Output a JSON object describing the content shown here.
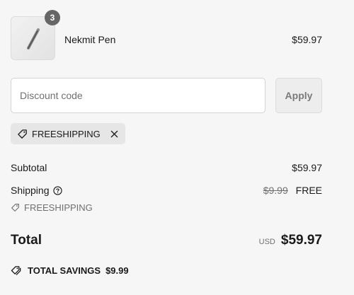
{
  "product": {
    "name": "Nekmit Pen",
    "price": "$59.97",
    "quantity": "3",
    "image_icon": "pen-image"
  },
  "discount": {
    "placeholder": "Discount code",
    "value": "",
    "apply_label": "Apply",
    "applied_code": "FREESHIPPING"
  },
  "summary": {
    "subtotal_label": "Subtotal",
    "subtotal_value": "$59.97",
    "shipping_label": "Shipping",
    "shipping_original": "$9.99",
    "shipping_value": "FREE",
    "shipping_code": "FREESHIPPING",
    "total_label": "Total",
    "currency": "USD",
    "total_value": "$59.97",
    "savings_label": "TOTAL SAVINGS",
    "savings_value": "$9.99"
  },
  "colors": {
    "background": "#f6f6f6",
    "badge": "#666666",
    "chip": "#e6e6e6",
    "muted_text": "#707070"
  }
}
